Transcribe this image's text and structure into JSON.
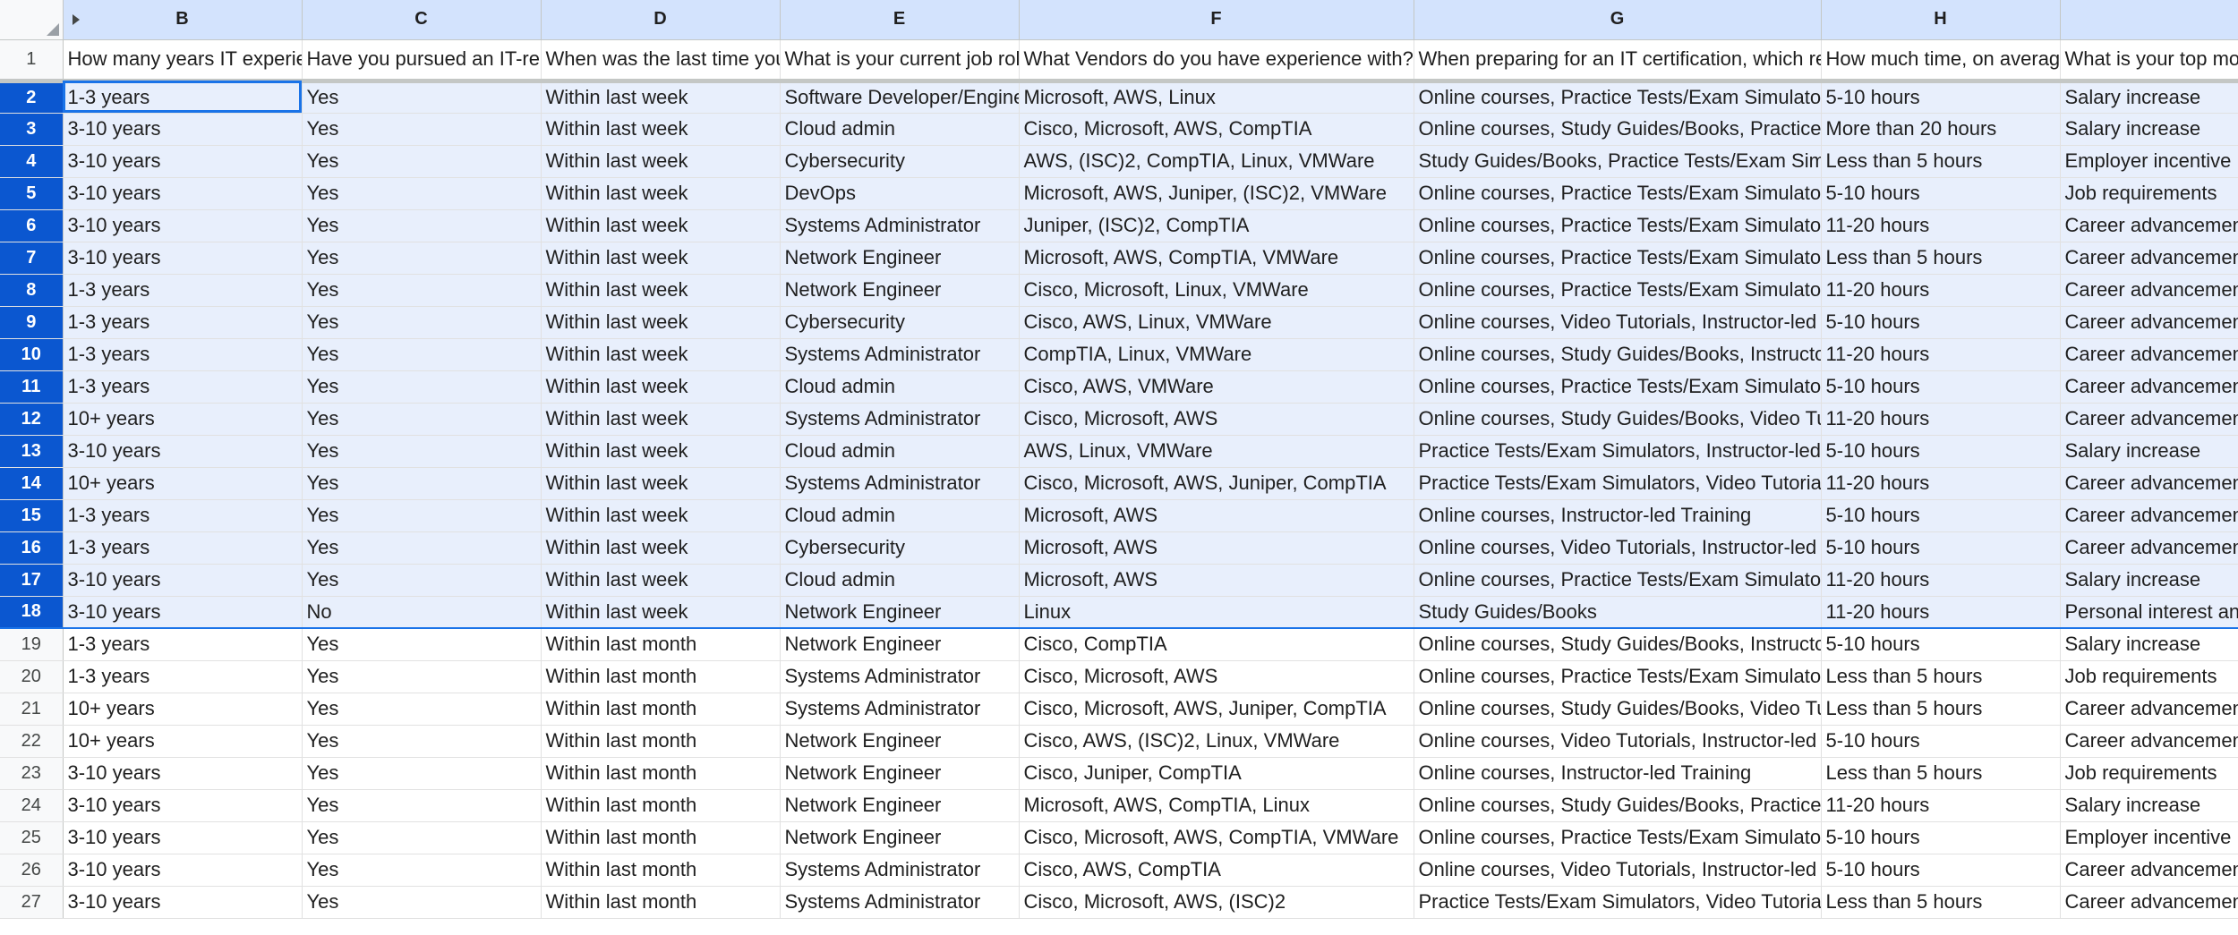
{
  "columns": [
    {
      "letter": "B",
      "width": 267
    },
    {
      "letter": "C",
      "width": 267
    },
    {
      "letter": "D",
      "width": 267
    },
    {
      "letter": "E",
      "width": 267
    },
    {
      "letter": "F",
      "width": 441
    },
    {
      "letter": "G",
      "width": 455
    },
    {
      "letter": "H",
      "width": 267
    },
    {
      "letter": "",
      "width": 212
    }
  ],
  "rows": [
    {
      "num": "1",
      "cells": [
        "How many years IT experience do you have?",
        "Have you pursued an IT-related certification?",
        "When was the last time you studied?",
        "What is your current job role?",
        "What Vendors do you have experience with?",
        "When preparing for an IT certification, which resources do you use?",
        "How much time, on average, do you spend studying?",
        "What is your top motivation?"
      ]
    },
    {
      "num": "2",
      "cells": [
        "1-3 years",
        "Yes",
        "Within last week",
        "Software Developer/Engineer",
        "Microsoft, AWS, Linux",
        "Online courses, Practice Tests/Exam Simulators",
        "5-10 hours",
        "Salary increase"
      ]
    },
    {
      "num": "3",
      "cells": [
        "3-10 years",
        "Yes",
        "Within last week",
        "Cloud admin",
        "Cisco, Microsoft, AWS, CompTIA",
        "Online courses, Study Guides/Books, Practice Tests",
        "More than 20 hours",
        "Salary increase"
      ]
    },
    {
      "num": "4",
      "cells": [
        "3-10 years",
        "Yes",
        "Within last week",
        "Cybersecurity",
        "AWS, (ISC)2, CompTIA, Linux, VMWare",
        "Study Guides/Books, Practice Tests/Exam Simulators",
        "Less than 5 hours",
        "Employer incentive"
      ]
    },
    {
      "num": "5",
      "cells": [
        "3-10 years",
        "Yes",
        "Within last week",
        "DevOps",
        "Microsoft, AWS, Juniper, (ISC)2, VMWare",
        "Online courses, Practice Tests/Exam Simulators",
        "5-10 hours",
        "Job requirements"
      ]
    },
    {
      "num": "6",
      "cells": [
        "3-10 years",
        "Yes",
        "Within last week",
        "Systems Administrator",
        "Juniper, (ISC)2, CompTIA",
        "Online courses, Practice Tests/Exam Simulators",
        "11-20 hours",
        "Career advancement"
      ]
    },
    {
      "num": "7",
      "cells": [
        "3-10 years",
        "Yes",
        "Within last week",
        "Network Engineer",
        "Microsoft, AWS, CompTIA, VMWare",
        "Online courses, Practice Tests/Exam Simulators",
        "Less than 5 hours",
        "Career advancement"
      ]
    },
    {
      "num": "8",
      "cells": [
        "1-3 years",
        "Yes",
        "Within last week",
        "Network Engineer",
        "Cisco, Microsoft, Linux, VMWare",
        "Online courses, Practice Tests/Exam Simulators",
        "11-20 hours",
        "Career advancement"
      ]
    },
    {
      "num": "9",
      "cells": [
        "1-3 years",
        "Yes",
        "Within last week",
        "Cybersecurity",
        "Cisco, AWS, Linux, VMWare",
        "Online courses, Video Tutorials, Instructor-led Training",
        "5-10 hours",
        "Career advancement"
      ]
    },
    {
      "num": "10",
      "cells": [
        "1-3 years",
        "Yes",
        "Within last week",
        "Systems Administrator",
        "CompTIA, Linux, VMWare",
        "Online courses, Study Guides/Books, Instructor-led Training",
        "11-20 hours",
        "Career advancement"
      ]
    },
    {
      "num": "11",
      "cells": [
        "1-3 years",
        "Yes",
        "Within last week",
        "Cloud admin",
        "Cisco, AWS, VMWare",
        "Online courses, Practice Tests/Exam Simulators",
        "5-10 hours",
        "Career advancement"
      ]
    },
    {
      "num": "12",
      "cells": [
        "10+ years",
        "Yes",
        "Within last week",
        "Systems Administrator",
        "Cisco, Microsoft, AWS",
        "Online courses, Study Guides/Books, Video Tutorials",
        "11-20 hours",
        "Career advancement"
      ]
    },
    {
      "num": "13",
      "cells": [
        "3-10 years",
        "Yes",
        "Within last week",
        "Cloud admin",
        "AWS, Linux, VMWare",
        "Practice Tests/Exam Simulators, Instructor-led Training",
        "5-10 hours",
        "Salary increase"
      ]
    },
    {
      "num": "14",
      "cells": [
        "10+ years",
        "Yes",
        "Within last week",
        "Systems Administrator",
        "Cisco, Microsoft, AWS, Juniper, CompTIA",
        "Practice Tests/Exam Simulators, Video Tutorials",
        "11-20 hours",
        "Career advancement"
      ]
    },
    {
      "num": "15",
      "cells": [
        "1-3 years",
        "Yes",
        "Within last week",
        "Cloud admin",
        "Microsoft, AWS",
        "Online courses, Instructor-led Training",
        "5-10 hours",
        "Career advancement"
      ]
    },
    {
      "num": "16",
      "cells": [
        "1-3 years",
        "Yes",
        "Within last week",
        "Cybersecurity",
        "Microsoft, AWS",
        "Online courses, Video Tutorials, Instructor-led Training",
        "5-10 hours",
        "Career advancement"
      ]
    },
    {
      "num": "17",
      "cells": [
        "3-10 years",
        "Yes",
        "Within last week",
        "Cloud admin",
        "Microsoft, AWS",
        "Online courses, Practice Tests/Exam Simulators",
        "11-20 hours",
        "Salary increase"
      ]
    },
    {
      "num": "18",
      "cells": [
        "3-10 years",
        "No",
        "Within last week",
        "Network Engineer",
        "Linux",
        "Study Guides/Books",
        "11-20 hours",
        "Personal interest and growth"
      ]
    },
    {
      "num": "19",
      "cells": [
        "1-3 years",
        "Yes",
        "Within last month",
        "Network Engineer",
        "Cisco, CompTIA",
        "Online courses, Study Guides/Books, Instructor-led Training",
        "5-10 hours",
        "Salary increase"
      ]
    },
    {
      "num": "20",
      "cells": [
        "1-3 years",
        "Yes",
        "Within last month",
        "Systems Administrator",
        "Cisco, Microsoft, AWS",
        "Online courses, Practice Tests/Exam Simulators",
        "Less than 5 hours",
        "Job requirements"
      ]
    },
    {
      "num": "21",
      "cells": [
        "10+ years",
        "Yes",
        "Within last month",
        "Systems Administrator",
        "Cisco, Microsoft, AWS, Juniper, CompTIA",
        "Online courses, Study Guides/Books, Video Tutorials",
        "Less than 5 hours",
        "Career advancement"
      ]
    },
    {
      "num": "22",
      "cells": [
        "10+ years",
        "Yes",
        "Within last month",
        "Network Engineer",
        "Cisco, AWS, (ISC)2, Linux, VMWare",
        "Online courses, Video Tutorials, Instructor-led Training",
        "5-10 hours",
        "Career advancement"
      ]
    },
    {
      "num": "23",
      "cells": [
        "3-10 years",
        "Yes",
        "Within last month",
        "Network Engineer",
        "Cisco, Juniper, CompTIA",
        "Online courses, Instructor-led Training",
        "Less than 5 hours",
        "Job requirements"
      ]
    },
    {
      "num": "24",
      "cells": [
        "3-10 years",
        "Yes",
        "Within last month",
        "Network Engineer",
        "Microsoft, AWS, CompTIA, Linux",
        "Online courses, Study Guides/Books, Practice Tests",
        "11-20 hours",
        "Salary increase"
      ]
    },
    {
      "num": "25",
      "cells": [
        "3-10 years",
        "Yes",
        "Within last month",
        "Network Engineer",
        "Cisco, Microsoft, AWS, CompTIA, VMWare",
        "Online courses, Practice Tests/Exam Simulators",
        "5-10 hours",
        "Employer incentive"
      ]
    },
    {
      "num": "26",
      "cells": [
        "3-10 years",
        "Yes",
        "Within last month",
        "Systems Administrator",
        "Cisco, AWS, CompTIA",
        "Online courses, Video Tutorials, Instructor-led Training",
        "5-10 hours",
        "Career advancement"
      ]
    },
    {
      "num": "27",
      "cells": [
        "3-10 years",
        "Yes",
        "Within last month",
        "Systems Administrator",
        "Cisco, Microsoft, AWS, (ISC)2",
        "Practice Tests/Exam Simulators, Video Tutorials",
        "Less than 5 hours",
        "Career advancement"
      ]
    }
  ],
  "selection": {
    "first_row": 2,
    "last_row": 18,
    "active_cell_row": 2,
    "active_cell_col": 0
  },
  "colors": {
    "selection_header": "#0b57d0",
    "selection_fill": "#e8effc",
    "column_header": "#d3e3fd",
    "active_border": "#1a73e8"
  }
}
